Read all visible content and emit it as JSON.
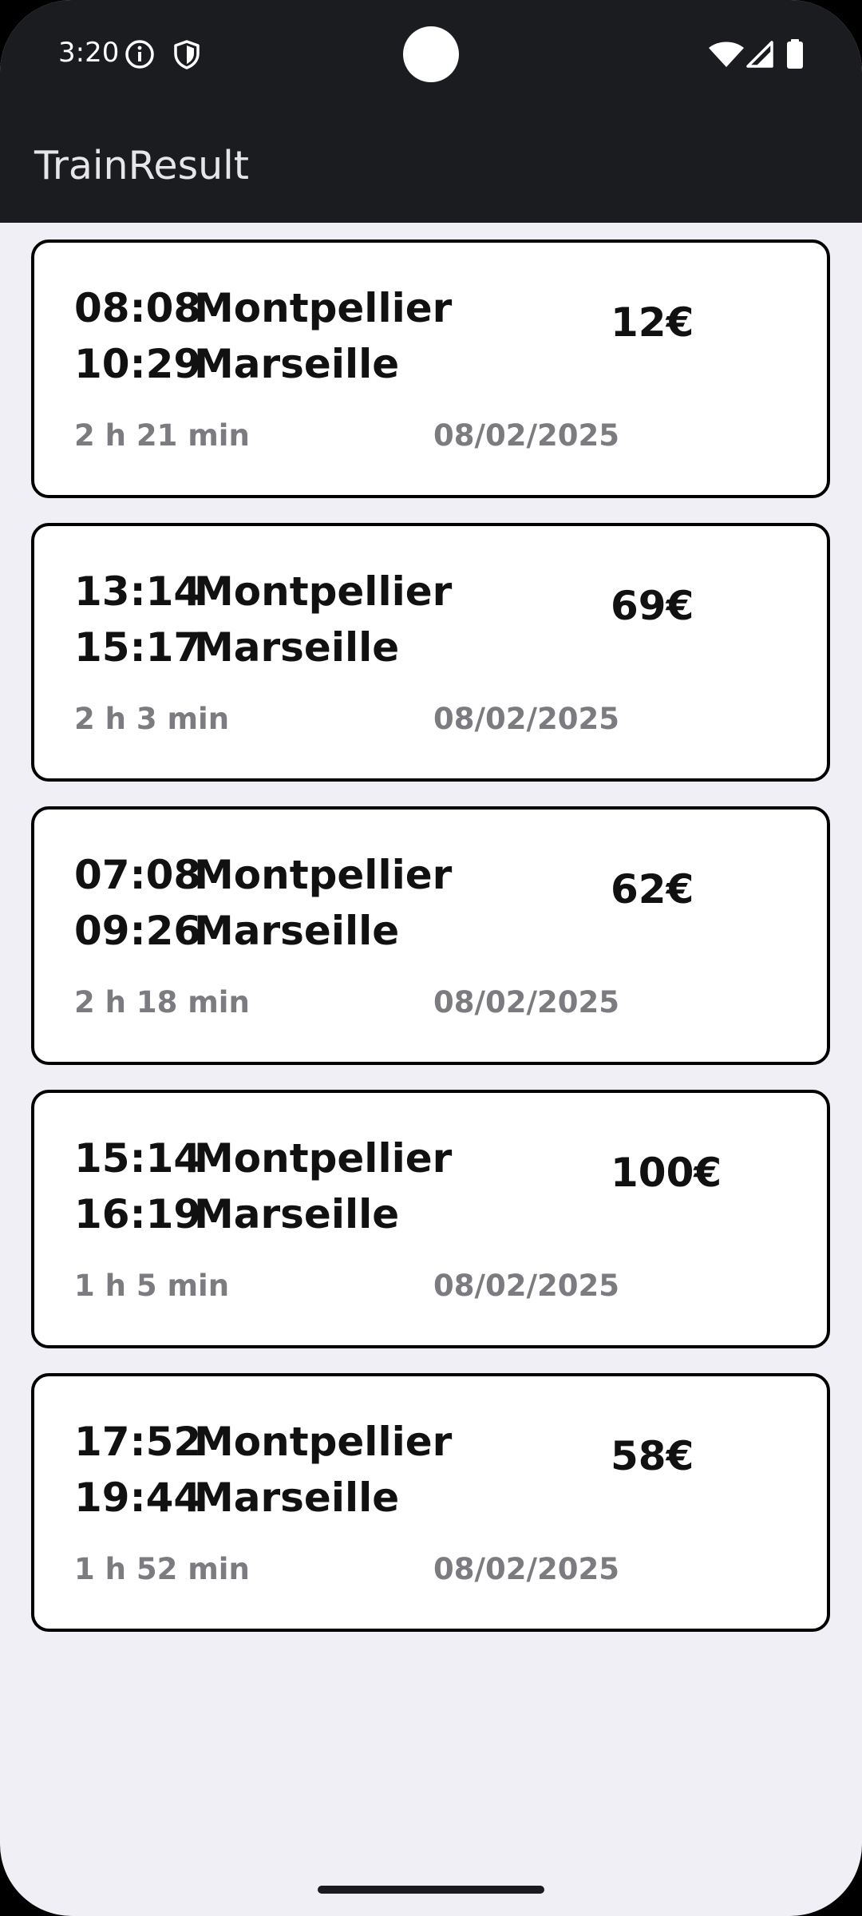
{
  "status_bar": {
    "time": "3:20",
    "left_icons": [
      "info-icon",
      "shield-icon"
    ],
    "right_icons": [
      "wifi-icon",
      "cellular-signal-icon",
      "battery-icon"
    ]
  },
  "app_bar": {
    "title": "TrainResult"
  },
  "results": [
    {
      "departure_time": "08:08",
      "departure_station": "Montpellier",
      "arrival_time": "10:29",
      "arrival_station": "Marseille",
      "price": "12€",
      "duration": "2 h 21 min",
      "date": "08/02/2025"
    },
    {
      "departure_time": "13:14",
      "departure_station": "Montpellier",
      "arrival_time": "15:17",
      "arrival_station": "Marseille",
      "price": "69€",
      "duration": "2 h 3 min",
      "date": "08/02/2025"
    },
    {
      "departure_time": "07:08",
      "departure_station": "Montpellier",
      "arrival_time": "09:26",
      "arrival_station": "Marseille",
      "price": "62€",
      "duration": "2 h 18 min",
      "date": "08/02/2025"
    },
    {
      "departure_time": "15:14",
      "departure_station": "Montpellier",
      "arrival_time": "16:19",
      "arrival_station": "Marseille",
      "price": "100€",
      "duration": "1 h 5 min",
      "date": "08/02/2025"
    },
    {
      "departure_time": "17:52",
      "departure_station": "Montpellier",
      "arrival_time": "19:44",
      "arrival_station": "Marseille",
      "price": "58€",
      "duration": "1 h 52 min",
      "date": "08/02/2025"
    }
  ],
  "colors": {
    "top_bar": "#1b1c20",
    "background": "#efeff5",
    "card": "#ffffff",
    "card_border": "#000000",
    "secondary_text": "#7b7b80"
  }
}
